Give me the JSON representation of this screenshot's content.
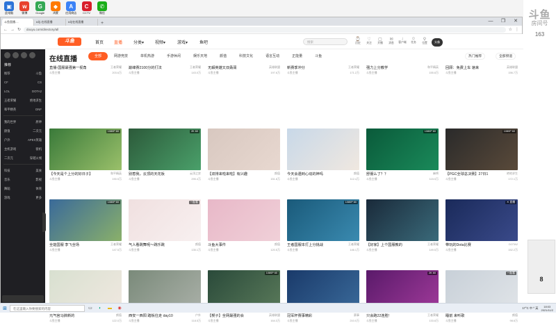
{
  "desktop_icons": [
    {
      "label": "此电脑",
      "color": "#2b73d8",
      "glyph": "▣"
    },
    {
      "label": "微博",
      "color": "#e8412d",
      "glyph": "w"
    },
    {
      "label": "Google",
      "color": "#34a853",
      "glyph": "G"
    },
    {
      "label": "鸿蒙",
      "color": "#ff7a00",
      "glyph": "◆"
    },
    {
      "label": "应用商店",
      "color": "#3b82f6",
      "glyph": "A"
    },
    {
      "label": "CCTV",
      "color": "#d81e2c",
      "glyph": "C"
    },
    {
      "label": "微信",
      "color": "#1aad19",
      "glyph": "✆"
    }
  ],
  "right_strip": {
    "logo": "斗鱼",
    "sub": "房间号",
    "num": "163",
    "small_num": "8"
  },
  "browser": {
    "tabs": [
      "斗鱼直播-...",
      "b站-在线直播",
      "b站在线直播"
    ],
    "url": "douyu.com/directory/all",
    "window_controls": [
      "—",
      "❐",
      "✕"
    ]
  },
  "topnav": {
    "logo": "斗鱼",
    "links": [
      "首页",
      "直播",
      "分类▾",
      "视频▾",
      "游戏▾",
      "鱼吧"
    ],
    "active_index": 1,
    "search_placeholder": "搜索",
    "icons": [
      {
        "glyph": "⌚",
        "label": "历史"
      },
      {
        "glyph": "♡",
        "label": "关注"
      },
      {
        "glyph": "▢",
        "label": "开播"
      },
      {
        "glyph": "✉",
        "label": "消息"
      },
      {
        "glyph": "↓",
        "label": "客户端"
      },
      {
        "glyph": "☺",
        "label": "任务"
      },
      {
        "glyph": "⚲",
        "label": "位置"
      }
    ],
    "avatar": "头像"
  },
  "sidebar": {
    "header": "推荐",
    "rows": [
      [
        "推荐",
        "斗鱼"
      ],
      [
        "CF",
        "CS"
      ],
      [
        "LOL",
        "DOTA2"
      ],
      [
        "王者荣耀",
        "绝地求生"
      ],
      [
        "和平精英",
        "DNF"
      ],
      [
        "我的世界",
        "原神"
      ],
      [
        "颜值",
        "二次元"
      ],
      [
        "户外",
        "APEX英雄"
      ],
      [
        "主机游戏",
        "街机"
      ],
      [
        "二次元",
        "穿越火线"
      ],
      [
        "科技",
        "美食"
      ],
      [
        "音乐",
        "影视"
      ],
      [
        "舞蹈",
        "体育"
      ],
      [
        "游戏",
        "更多"
      ]
    ]
  },
  "page_title": "在线直播",
  "categories": [
    "全部",
    "网游竞技",
    "单机热游",
    "手游休闲",
    "娱乐天地",
    "颜值",
    "科技文化",
    "语言互动",
    "正能量",
    "斗鱼"
  ],
  "active_category": 0,
  "right_buttons": [
    "热门推荐",
    "全部频道"
  ],
  "partial_row": [
    {
      "t": "直播-国服最强第一视角",
      "c": "王者荣耀",
      "a": "斗鱼主播",
      "v": "203.6万"
    },
    {
      "t": "巅峰赛2100分的打法",
      "c": "王者荣耀",
      "a": "斗鱼主播",
      "v": "143.0万"
    },
    {
      "t": "无解英雄又双叒叕",
      "c": "英雄联盟",
      "a": "斗鱼主播",
      "v": "197.6万"
    },
    {
      "t": "新赛季冲分",
      "c": "王者荣耀",
      "a": "斗鱼主播",
      "v": "171.2万"
    },
    {
      "t": "强力上分教学",
      "c": "和平精英",
      "a": "斗鱼主播",
      "v": "155.8万"
    },
    {
      "t": "回顾：免费上车 速来",
      "c": "英雄联盟",
      "a": "斗鱼主播",
      "v": "156.7万"
    }
  ],
  "cards": [
    {
      "t": "【今天是个上分的好日子】",
      "c": "和平精英",
      "a": "斗鱼主播",
      "v": "190.5万",
      "badge": "1080P 60",
      "bg": "#3a7a3a",
      "bg2": "#9ac06a"
    },
    {
      "t": "别惹我，云顶的天花板",
      "c": "云顶之弈",
      "a": "斗鱼主播",
      "v": "295.4万",
      "badge": "2K 60",
      "bg": "#2c5a3a",
      "bg2": "#4aa06a"
    },
    {
      "t": "【双排来啦来啦】有兴趣",
      "c": "颜值",
      "a": "斗鱼主播",
      "v": "151.8万",
      "badge": "",
      "bg": "#d8c8c0",
      "bg2": "#e8d8d0"
    },
    {
      "t": "今天会遇到心动的神吗",
      "c": "颜值",
      "a": "斗鱼主播",
      "v": "112.4万",
      "badge": "",
      "bg": "#c8d8e8",
      "bg2": "#f0e8e0"
    },
    {
      "t": "舒服么了？？",
      "c": "麻将",
      "a": "斗鱼主播",
      "v": "115.5万",
      "badge": "1080P 60",
      "bg": "#0a5a3a",
      "bg2": "#1a8a5a"
    },
    {
      "t": "【PGC全球总决赛】27日1",
      "c": "绝地求生",
      "a": "斗鱼主播",
      "v": "172.1万",
      "badge": "1080P 60",
      "bg": "#2a2a2a",
      "bg2": "#5a4a3a"
    },
    {
      "t": "全能国服 李飞全场",
      "c": "王者荣耀",
      "a": "斗鱼主播",
      "v": "147.5万",
      "badge": "1080P 60",
      "bg": "#3a6a9a",
      "bg2": "#8ab06a"
    },
    {
      "t": "气人看跳舞呢～跳乐跳",
      "c": "颜值",
      "a": "斗鱼主播",
      "v": "135.1万",
      "badge": "一起看",
      "bg": "#f0e0e0",
      "bg2": "#f8f0f0"
    },
    {
      "t": "斗鱼大事件",
      "c": "颜值",
      "a": "斗鱼主播",
      "v": "120.5万",
      "badge": "",
      "bg": "#e8b8c8",
      "bg2": "#f0d0d8"
    },
    {
      "t": "王者国服本打上分挑战",
      "c": "王者荣耀",
      "a": "斗鱼主播",
      "v": "146.1万",
      "badge": "1080P 60",
      "bg": "#1a5a7a",
      "bg2": "#3a8ab0"
    },
    {
      "t": "【好家】上个国服教的",
      "c": "王者荣耀",
      "a": "斗鱼主播",
      "v": "149.5万",
      "badge": "",
      "bg": "#1a2a3a",
      "bg2": "#3a6a7a"
    },
    {
      "t": "带玩的Dota比赛",
      "c": "DOTA2",
      "a": "斗鱼主播",
      "v": "152.2万",
      "badge": "✕ 直播",
      "bg": "#1a2a5a",
      "bg2": "#3a4a8a"
    },
    {
      "t": "元气宫马搞新的",
      "c": "颜值",
      "a": "斗鱼主播",
      "v": "122.0万",
      "badge": "",
      "bg": "#d8e0d0",
      "bg2": "#f0e8e0"
    },
    {
      "t": "西安一西阳 踏板往走 day10",
      "c": "户外",
      "a": "斗鱼主播",
      "v": "118.5万",
      "badge": "",
      "bg": "#7a8a7a",
      "bg2": "#aab0a8"
    },
    {
      "t": "【楔子】全网最强的会",
      "c": "英雄联盟",
      "a": "斗鱼主播",
      "v": "164.3万",
      "badge": "1080P 60",
      "bg": "#2a4a3a",
      "bg2": "#5a7a5a"
    },
    {
      "t": "冠军杯赛事精彩",
      "c": "赛事",
      "a": "斗鱼主播",
      "v": "210.0万",
      "badge": "",
      "bg": "#1a3a6a",
      "bg2": "#3a6a9a"
    },
    {
      "t": "只会跑22连胜!",
      "c": "王者荣耀",
      "a": "斗鱼主播",
      "v": "133.8万",
      "badge": "2K 60",
      "bg": "#5a1a6a",
      "bg2": "#a03a9a"
    },
    {
      "t": "睡前 来听歌",
      "c": "颜值",
      "a": "斗鱼主播",
      "v": "98.6万",
      "badge": "一起看",
      "bg": "#c8d0d8",
      "bg2": "#e0e4e8"
    }
  ],
  "taskbar": {
    "search": "在这里输入你要搜索的内容",
    "tray": "17°C 中 ^ 英",
    "time": "18:03",
    "date": "2021/11/2"
  }
}
